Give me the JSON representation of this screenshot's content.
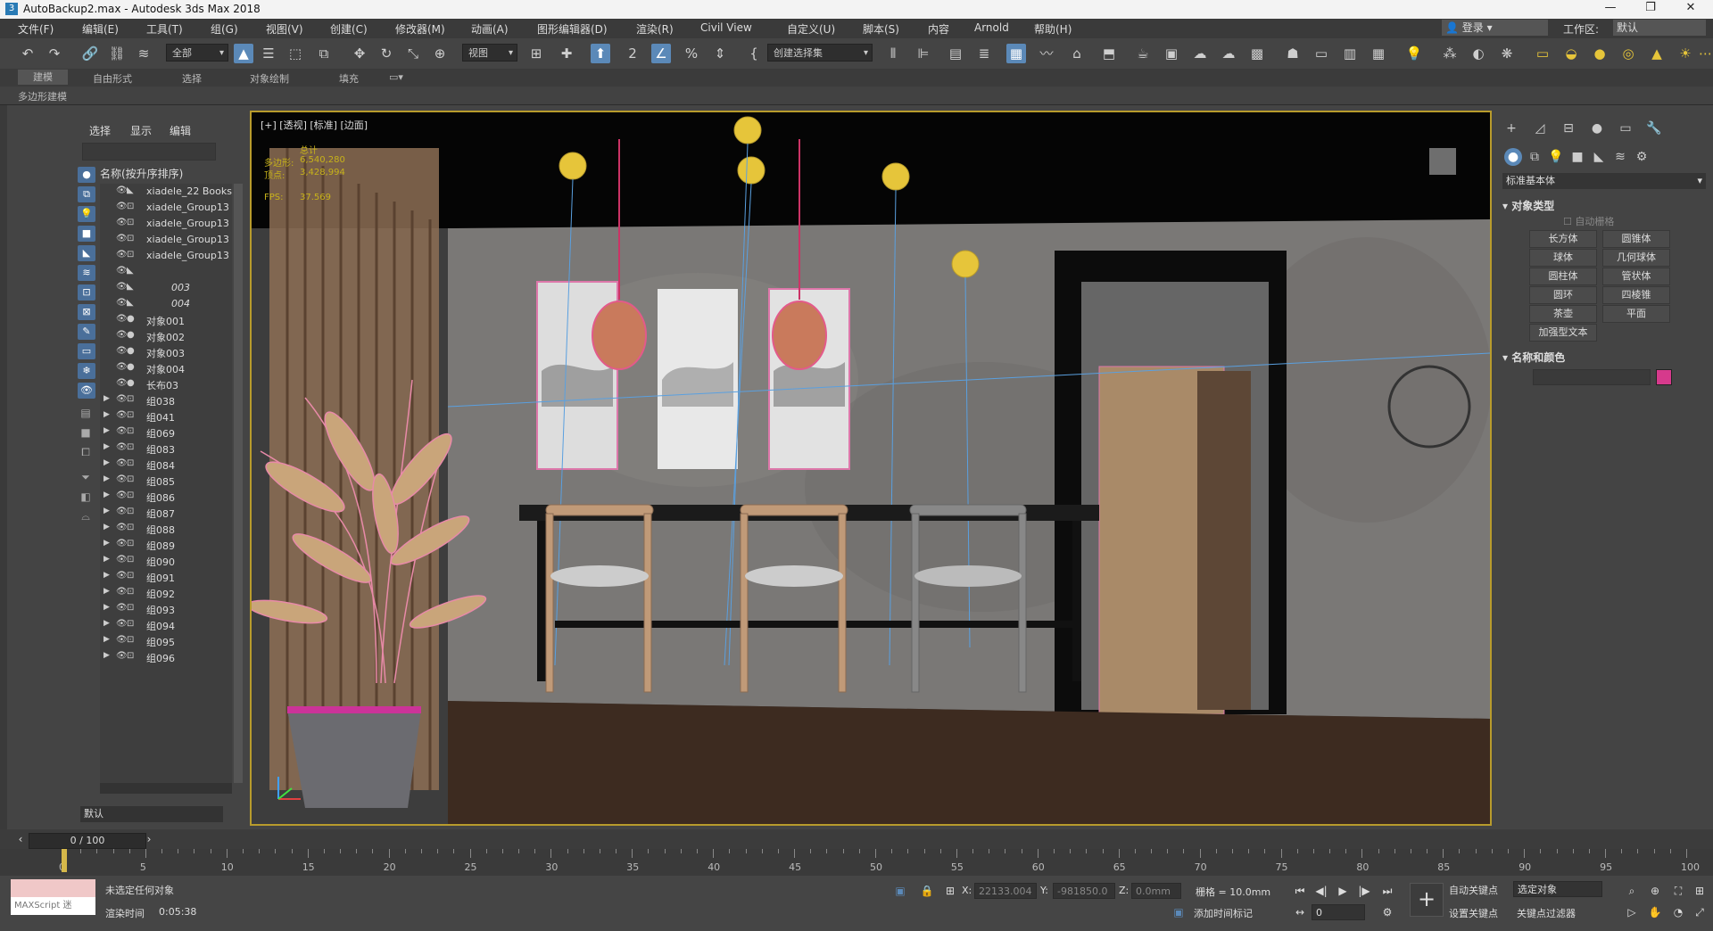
{
  "window": {
    "title": "AutoBackup2.max - Autodesk 3ds Max 2018",
    "app_icon": "3"
  },
  "menu": [
    "文件(F)",
    "编辑(E)",
    "工具(T)",
    "组(G)",
    "视图(V)",
    "创建(C)",
    "修改器(M)",
    "动画(A)",
    "图形编辑器(D)",
    "渲染(R)",
    "Civil View",
    "自定义(U)",
    "脚本(S)",
    "内容",
    "Arnold",
    "帮助(H)"
  ],
  "account": {
    "login": "登录",
    "workspace_label": "工作区:",
    "workspace_value": "默认"
  },
  "toolbar": {
    "filter": "全部",
    "view_dropdown": "视图",
    "selection_set": "创建选择集"
  },
  "ribbon": {
    "tabs": [
      "建模",
      "自由形式",
      "选择",
      "对象绘制",
      "填充"
    ],
    "sub": "多边形建模"
  },
  "scene_explorer": {
    "tabs": [
      "选择",
      "显示",
      "编辑"
    ],
    "header": "名称(按升序排序)",
    "rows": [
      {
        "name": "xiadele_22 Books",
        "type": "tri",
        "expanded": false,
        "italic": false
      },
      {
        "name": "xiadele_Group13",
        "type": "group",
        "italic": false
      },
      {
        "name": "xiadele_Group13",
        "type": "group",
        "italic": false
      },
      {
        "name": "xiadele_Group13",
        "type": "group",
        "italic": false
      },
      {
        "name": "xiadele_Group13",
        "type": "group",
        "italic": false
      },
      {
        "name": "",
        "type": "tri",
        "italic": false
      },
      {
        "name": "003",
        "type": "tri",
        "italic": true
      },
      {
        "name": "004",
        "type": "tri",
        "italic": true
      },
      {
        "name": "对象001",
        "type": "dot",
        "italic": false
      },
      {
        "name": "对象002",
        "type": "dot",
        "italic": false
      },
      {
        "name": "对象003",
        "type": "dot",
        "italic": false
      },
      {
        "name": "对象004",
        "type": "dot",
        "italic": false
      },
      {
        "name": "长布03",
        "type": "dot",
        "italic": false
      },
      {
        "name": "组038",
        "type": "group",
        "arrow": true
      },
      {
        "name": "组041",
        "type": "group",
        "arrow": true
      },
      {
        "name": "组069",
        "type": "group",
        "arrow": true
      },
      {
        "name": "组083",
        "type": "group",
        "arrow": true
      },
      {
        "name": "组084",
        "type": "group",
        "arrow": true
      },
      {
        "name": "组085",
        "type": "group",
        "arrow": true
      },
      {
        "name": "组086",
        "type": "group",
        "arrow": true
      },
      {
        "name": "组087",
        "type": "group",
        "arrow": true
      },
      {
        "name": "组088",
        "type": "group",
        "arrow": true
      },
      {
        "name": "组089",
        "type": "group",
        "arrow": true
      },
      {
        "name": "组090",
        "type": "group",
        "arrow": true
      },
      {
        "name": "组091",
        "type": "group",
        "arrow": true
      },
      {
        "name": "组092",
        "type": "group",
        "arrow": true
      },
      {
        "name": "组093",
        "type": "group",
        "arrow": true
      },
      {
        "name": "组094",
        "type": "group",
        "arrow": true
      },
      {
        "name": "组095",
        "type": "group",
        "arrow": true
      },
      {
        "name": "组096",
        "type": "group",
        "arrow": true
      }
    ],
    "layer": "默认"
  },
  "viewport": {
    "label": "[+] [透视] [标准] [边面]",
    "stats": {
      "title": "总计",
      "polys_label": "多边形:",
      "polys_value": "6,540,280",
      "verts_label": "顶点:",
      "verts_value": "3,428,994",
      "fps_label": "FPS:",
      "fps_value": "37.569"
    }
  },
  "command_panel": {
    "category": "标准基本体",
    "object_type": "对象类型",
    "autogrid": "自动栅格",
    "buttons": [
      "长方体",
      "圆锥体",
      "球体",
      "几何球体",
      "圆柱体",
      "管状体",
      "圆环",
      "四棱锥",
      "茶壶",
      "平面",
      "加强型文本"
    ],
    "name_color": "名称和颜色",
    "color": "#d63a8c"
  },
  "timeline": {
    "frame": "0 / 100",
    "ticks": [
      0,
      5,
      10,
      15,
      20,
      25,
      30,
      35,
      40,
      45,
      50,
      55,
      60,
      65,
      70,
      75,
      80,
      85,
      90,
      95,
      100
    ]
  },
  "status": {
    "selection": "未选定任何对象",
    "render_time_label": "渲染时间",
    "render_time": "0:05:38",
    "maxscript": "MAXScript 迷",
    "x_label": "X:",
    "x_value": "22133.004",
    "y_label": "Y:",
    "y_value": "-981850.0",
    "z_label": "Z:",
    "z_value": "0.0mm",
    "grid": "栅格 = 10.0mm",
    "add_time_tag": "添加时间标记",
    "auto_key": "自动关键点",
    "set_key": "设置关键点",
    "selected_object": "选定对象",
    "key_filters": "关键点过滤器",
    "frame_value": "0"
  }
}
